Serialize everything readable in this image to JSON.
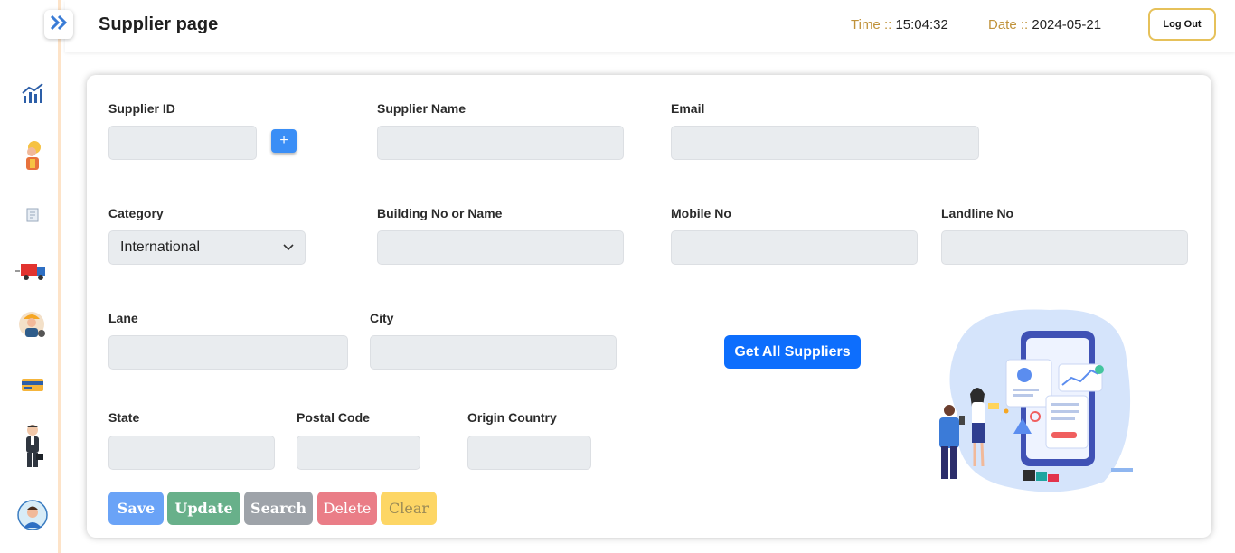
{
  "header": {
    "title": "Supplier page",
    "time_label": "Time ::",
    "time_value": "15:04:32",
    "date_label": "Date ::",
    "date_value": "2024-05-21",
    "logout_label": "Log Out"
  },
  "sidebar": {
    "items": [
      {
        "icon": "chart-icon"
      },
      {
        "icon": "worker-icon"
      },
      {
        "icon": "document-icon"
      },
      {
        "icon": "delivery-truck-icon"
      },
      {
        "icon": "engineer-icon"
      },
      {
        "icon": "credit-card-icon"
      },
      {
        "icon": "businessman-icon"
      },
      {
        "icon": "user-avatar-icon"
      }
    ]
  },
  "form": {
    "supplier_id_label": "Supplier ID",
    "add_button_label": "+",
    "supplier_name_label": "Supplier Name",
    "email_label": "Email",
    "category_label": "Category",
    "category_value": "International",
    "building_label": "Building No or Name",
    "mobile_label": "Mobile No",
    "landline_label": "Landline No",
    "lane_label": "Lane",
    "city_label": "City",
    "state_label": "State",
    "postal_label": "Postal Code",
    "country_label": "Origin Country",
    "get_all_label": "Get All Suppliers"
  },
  "actions": {
    "save": "Save",
    "update": "Update",
    "search": "Search",
    "delete": "Delete",
    "clear": "Clear"
  },
  "colors": {
    "save": "#6aa3f7",
    "update": "#68b08a",
    "search": "#9ea3a9",
    "delete": "#ea7d87",
    "clear": "#fdd665",
    "accent": "#0d6efd",
    "label_gold": "#c0923a"
  }
}
